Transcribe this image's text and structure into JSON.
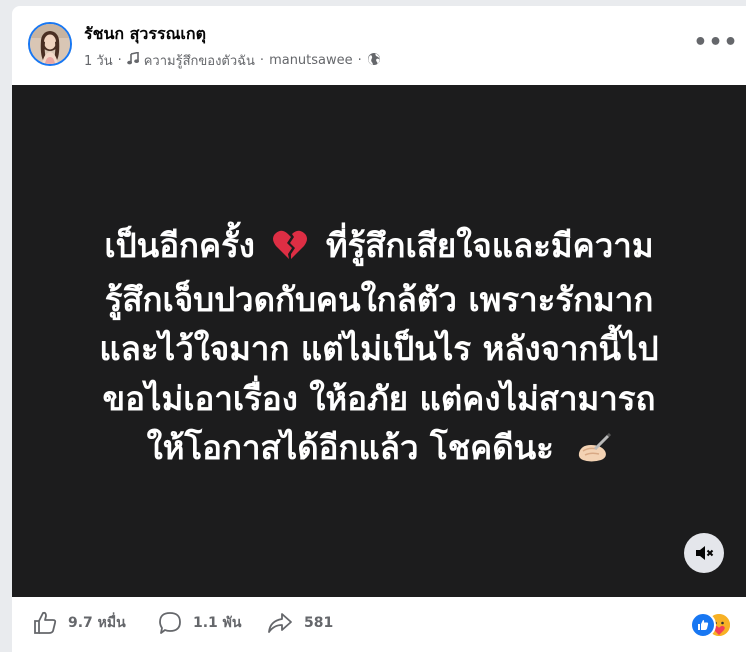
{
  "post": {
    "author": "รัชนก สุวรรณเกตุ",
    "time": "1 วัน",
    "song": "ความรู้สึกของตัวฉัน",
    "artist": "manutsawee",
    "separator": "·",
    "more_label": "•••",
    "privacy_icon": "globe-icon"
  },
  "media": {
    "lines": [
      "เป็นอีกครั้ง",
      "ที่รู้สึกเสียใจและมีความ",
      "รู้สึกเจ็บปวดกับคนใกล้ตัว เพราะรักมาก",
      "และไว้ใจมาก แต่ไม่เป็นไร หลังจากนี้ไป",
      "ขอไม่เอาเรื่อง ให้อภัย แต่คงไม่สามารถ",
      "ให้โอกาสได้อีกแล้ว โชคดีนะ"
    ],
    "background": "#1c1c1d",
    "mute_icon": "speaker-mute-icon"
  },
  "footer": {
    "likes": "9.7 หมื่น",
    "comments": "1.1 พัน",
    "shares": "581",
    "reaction_icons": [
      "like-reaction-icon",
      "care-reaction-icon"
    ]
  },
  "colors": {
    "brand_blue": "#1877f2",
    "secondary_text": "#65676b"
  }
}
